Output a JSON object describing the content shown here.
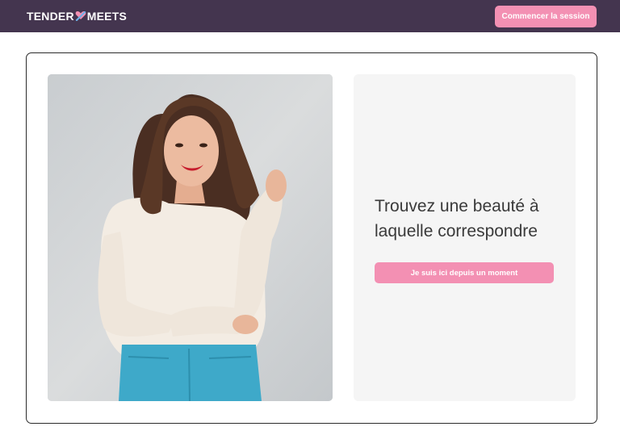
{
  "header": {
    "logo_left": "TENDER",
    "logo_right": "MEETS",
    "logo_icon": "heart-check-icon",
    "login_button": "Commencer la session"
  },
  "hero": {
    "photo": "woman-portrait-photo",
    "headline": "Trouvez une beauté à laquelle correspondre",
    "cta_button": "Je suis ici depuis un moment"
  },
  "colors": {
    "header_bg": "#44354f",
    "accent_pink": "#f390b3",
    "panel_bg": "#f5f5f5",
    "text_dark": "#3a3a3a"
  }
}
